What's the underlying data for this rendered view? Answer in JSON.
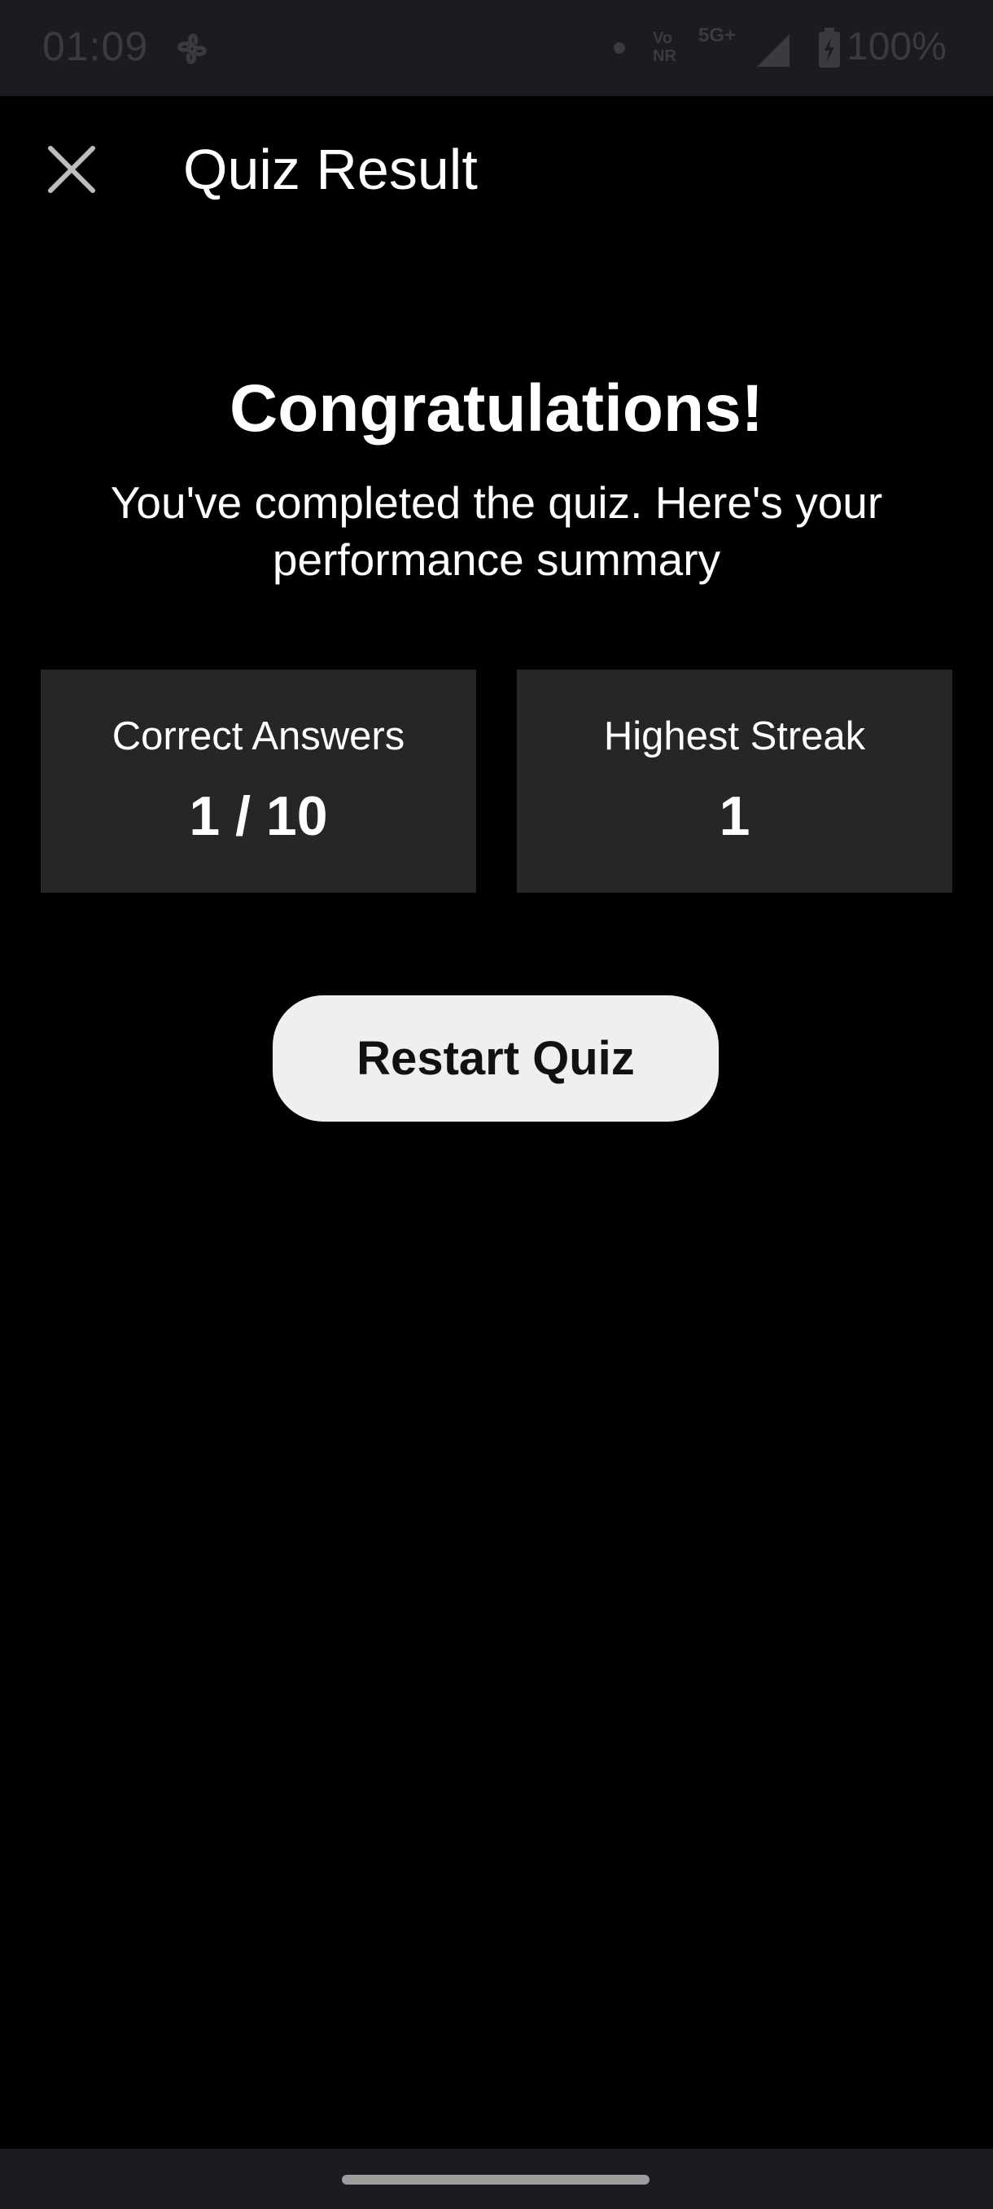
{
  "status_bar": {
    "time": "01:09",
    "volte_line1": "Vo",
    "volte_line2": "NR",
    "network": "5G+",
    "battery": "100%"
  },
  "app_bar": {
    "title": "Quiz Result",
    "close_icon": "close-icon"
  },
  "result": {
    "headline": "Congratulations!",
    "subtitle": "You've completed the quiz. Here's your performance summary"
  },
  "stats": {
    "correct_label": "Correct Answers",
    "correct_value": "1 / 10",
    "streak_label": "Highest Streak",
    "streak_value": "1"
  },
  "actions": {
    "restart_label": "Restart Quiz"
  },
  "colors": {
    "background": "#000000",
    "card": "#262626",
    "button": "#efefef",
    "status_bar": "#1b1c21"
  }
}
